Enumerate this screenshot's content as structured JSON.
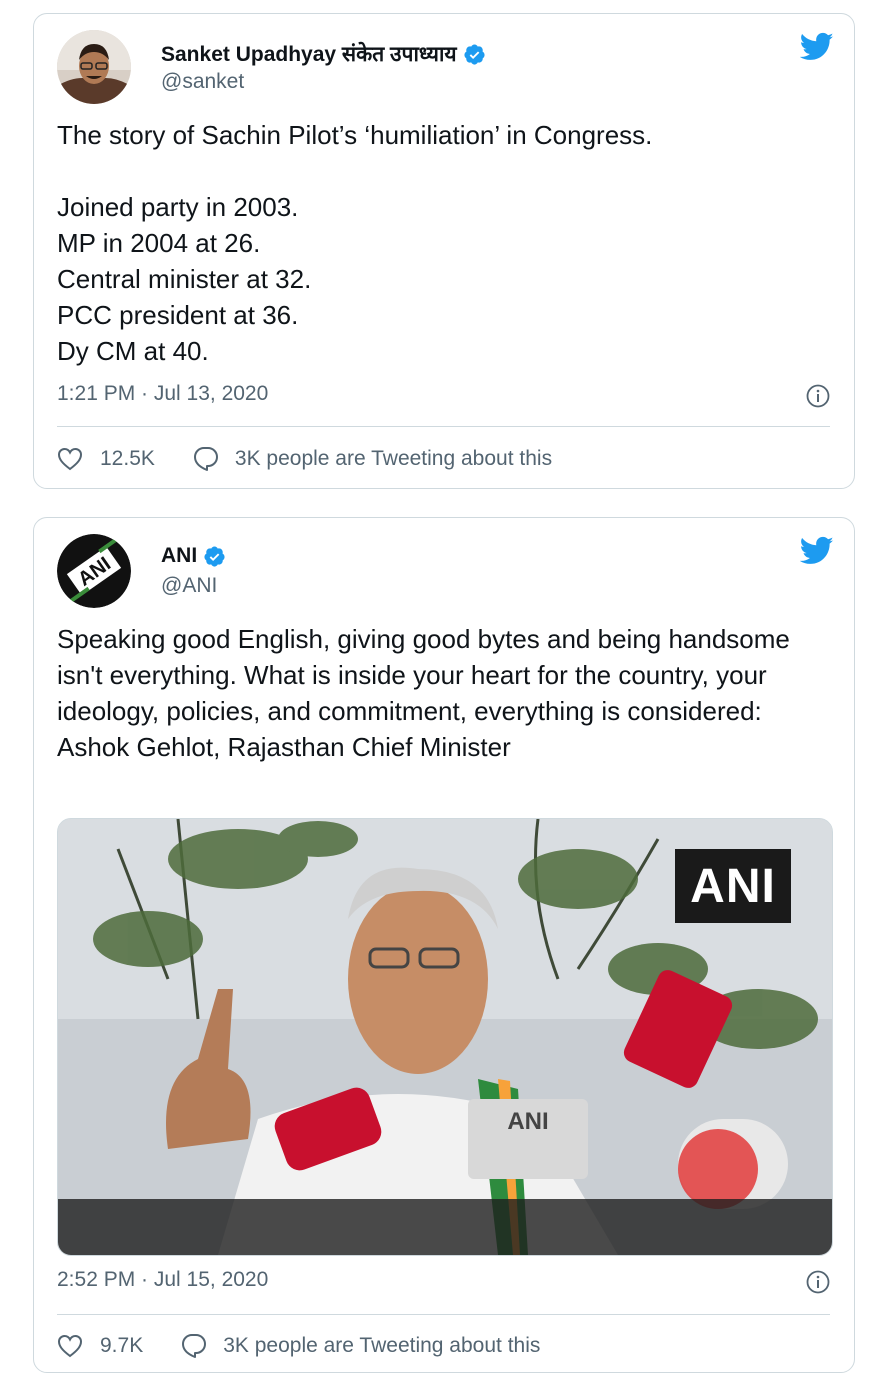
{
  "tweets": [
    {
      "author_name": "Sanket Upadhyay संकेत उपाध्याय",
      "handle": "@sanket",
      "text": "The story of Sachin Pilot’s ‘humiliation’ in Congress.\n\nJoined party in 2003.\nMP in 2004 at 26.\nCentral minister at 32.\nPCC president at 36.\nDy CM at 40.",
      "timestamp": "1:21 PM · Jul 13, 2020",
      "likes": "12.5K",
      "tweeting_about": "3K people are Tweeting about this"
    },
    {
      "author_name": "ANI",
      "handle": "@ANI",
      "text": "Speaking good English, giving good bytes and being handsome isn't everything. What is inside your heart for the country, your ideology, policies, and commitment, everything is considered: Ashok Gehlot, Rajasthan Chief Minister",
      "timestamp": "2:52 PM · Jul 15, 2020",
      "likes": "9.7K",
      "tweeting_about": "3K people are Tweeting about this",
      "media_watermark": "ANI",
      "avatar_text": "ANI"
    }
  ],
  "colors": {
    "twitter_blue": "#1d9bf0",
    "text": "#0f1419",
    "secondary": "#536471",
    "border": "#cfd9de"
  },
  "icons": [
    "twitter-bird-icon",
    "verified-badge-icon",
    "info-icon",
    "heart-icon",
    "speech-bubble-icon"
  ]
}
